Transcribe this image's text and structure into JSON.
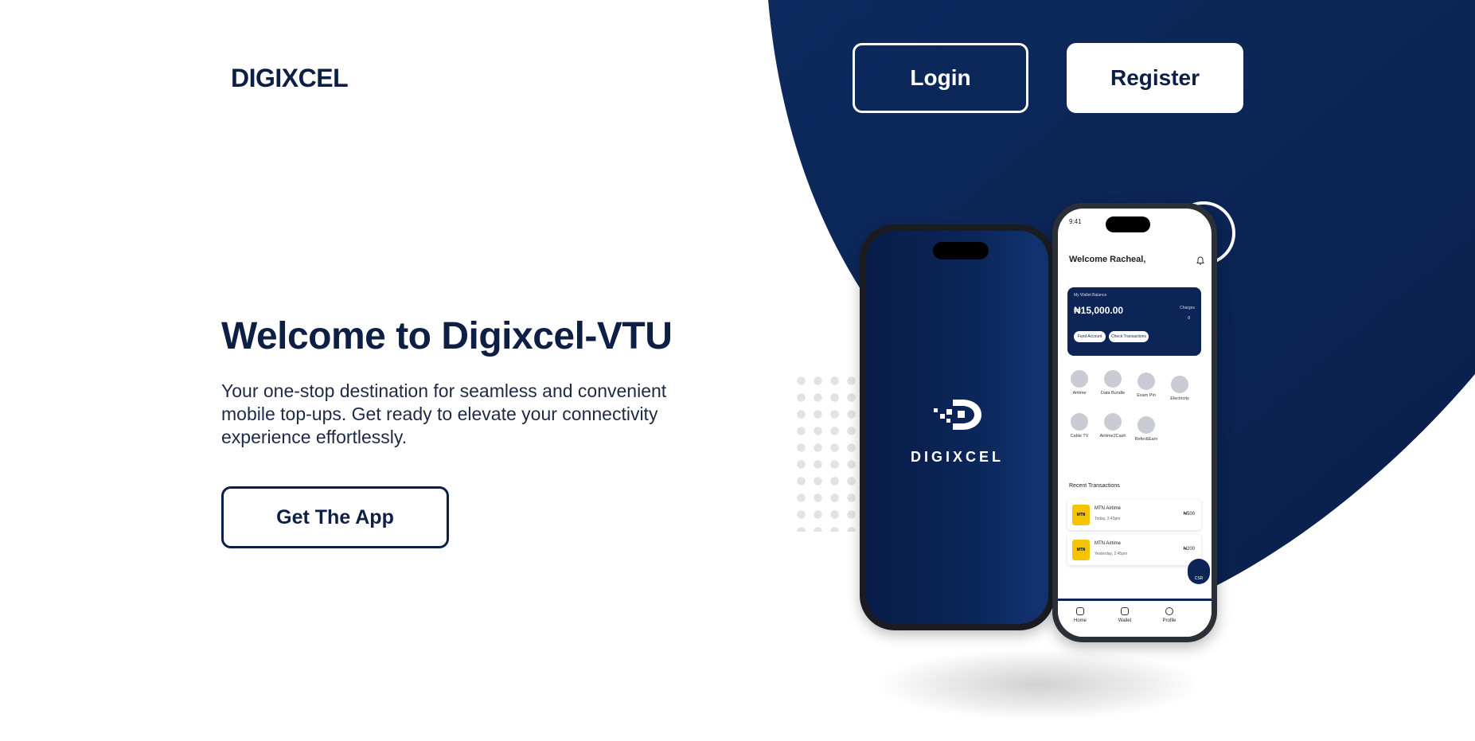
{
  "header": {
    "logo": "DIGIXCEL",
    "login_label": "Login",
    "register_label": "Register"
  },
  "hero": {
    "title": "Welcome to Digixcel-VTU",
    "subtitle": "Your one-stop destination for seamless and convenient mobile top-ups. Get ready to elevate your connectivity experience effortlessly.",
    "cta_label": "Get The App"
  },
  "phone_left": {
    "brand": "DIGIXCEL"
  },
  "phone_right": {
    "time": "9:41",
    "welcome": "Welcome Racheal,",
    "wallet_label": "My Wallet Balance",
    "balance": "₦15,000.00",
    "charges_label": "Charges",
    "charges_value": "0",
    "fund_label": "Fund Account",
    "check_label": "Check Transactions",
    "services": [
      "Airtime",
      "Data Bundle",
      "Exam Pin",
      "Electricity",
      "Cable TV",
      "Airtime2Cash",
      "Refer&Earn"
    ],
    "recent_label": "Recent Transactions",
    "transactions": [
      {
        "logo": "MTN",
        "name": "MTN Airtime",
        "date": "Today, 3:45pm",
        "amount": "₦500"
      },
      {
        "logo": "MTN",
        "name": "MTN Airtime",
        "date": "Yesterday, 2:45pm",
        "amount": "₦200"
      }
    ],
    "csr_label": "CSR",
    "nav": [
      "Home",
      "Wallet",
      "Profile"
    ]
  },
  "colors": {
    "brand_navy": "#0d1f44",
    "panel_navy": "#0b2659",
    "white": "#ffffff",
    "mtn_yellow": "#f5c400"
  }
}
